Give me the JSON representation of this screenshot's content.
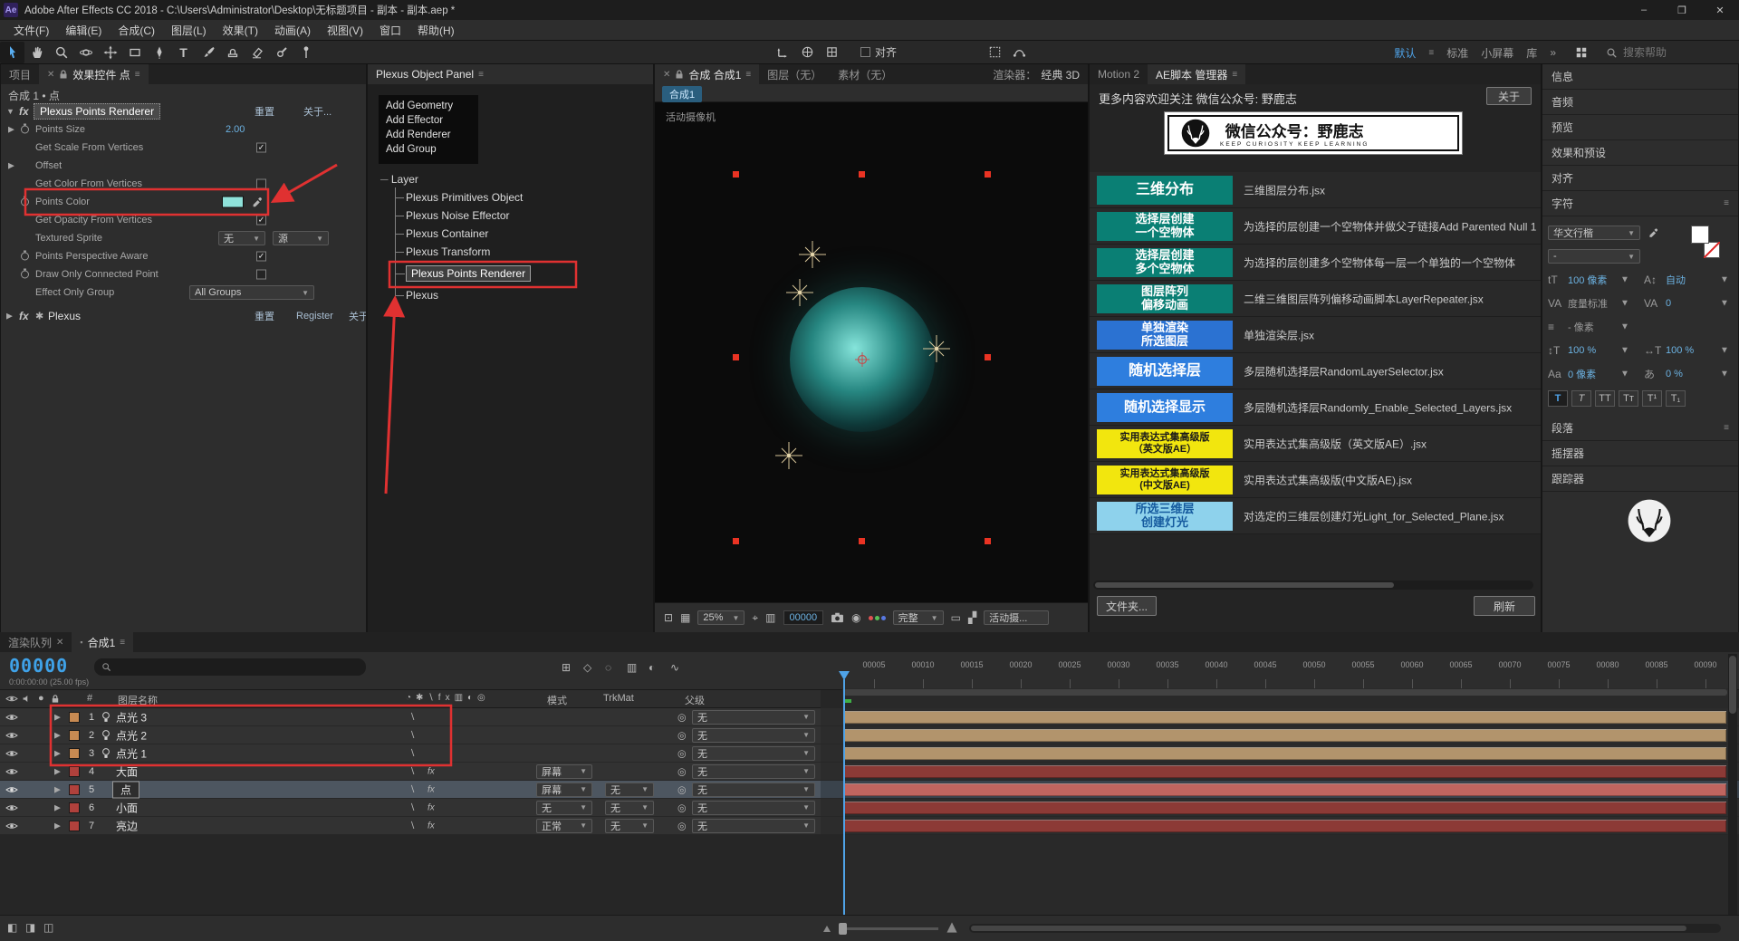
{
  "colors": {
    "accent": "#3fa2e8",
    "annotation": "#e03131",
    "value": "#6cb2e2"
  },
  "window": {
    "badge": "Ae",
    "title": "Adobe After Effects CC 2018 - C:\\Users\\Administrator\\Desktop\\无标题项目 - 副本 - 副本.aep *",
    "minimize": "–",
    "maximize": "❐",
    "close": "✕"
  },
  "menubar": {
    "items": [
      "文件(F)",
      "编辑(E)",
      "合成(C)",
      "图层(L)",
      "效果(T)",
      "动画(A)",
      "视图(V)",
      "窗口",
      "帮助(H)"
    ]
  },
  "toolbar": {
    "snap_label": "对齐",
    "workspaces": [
      "默认",
      "标准",
      "小屏幕",
      "库"
    ],
    "more": "»",
    "search_placeholder": "搜索帮助"
  },
  "effects_panel": {
    "tab_project": "项目",
    "tab_title": "效果控件 点",
    "breadcrumb": "合成 1 • 点",
    "ppr": {
      "fx": "fx",
      "title": "Plexus Points Renderer",
      "reset": "重置",
      "about": "关于...",
      "points_size_label": "Points Size",
      "points_size_value": "2.00",
      "get_scale_label": "Get Scale From Vertices",
      "get_scale_checked": true,
      "offset_label": "Offset",
      "get_color_label": "Get Color From Vertices",
      "get_color_checked": false,
      "points_color_label": "Points Color",
      "points_color_swatch": "#8fe2da",
      "get_opacity_label": "Get Opacity From Vertices",
      "get_opacity_checked": true,
      "textured_sprite_label": "Textured Sprite",
      "textured_sprite_layer": "无",
      "textured_sprite_source": "源",
      "perspective_label": "Points Perspective Aware",
      "perspective_checked": true,
      "draw_connected_label": "Draw Only Connected Point",
      "draw_connected_checked": false,
      "effect_group_label": "Effect Only Group",
      "effect_group_value": "All Groups"
    },
    "plexus": {
      "fx": "fx",
      "title": "Plexus",
      "reset": "重置",
      "register": "Register",
      "about": "关于..."
    }
  },
  "plexus_panel": {
    "title": "Plexus Object Panel",
    "actions": [
      "Add Geometry",
      "Add Effector",
      "Add Renderer",
      "Add Group"
    ],
    "root": "Layer",
    "items": [
      "Plexus Primitives Object",
      "Plexus Noise Effector",
      "Plexus Container",
      "Plexus Transform",
      "Plexus Points Renderer",
      "Plexus"
    ]
  },
  "viewer": {
    "tab_comp": "合成 合成1",
    "tab_layer": "图层（无）",
    "tab_footage": "素材（无）",
    "renderer_label": "渲染器：",
    "renderer_value": "经典 3D",
    "nav_badge": "合成1",
    "camera_overlay": "活动摄像机",
    "zoom": "25%",
    "timecode": "00000",
    "resolution": "完整",
    "view": "活动摄..."
  },
  "scripts_panel": {
    "tab_motion": "Motion 2",
    "tab_manager": "AE脚本 管理器",
    "header": "更多内容欢迎关注 微信公众号: 野鹿志",
    "about_btn": "关于",
    "banner_title": "微信公众号：野鹿志",
    "banner_sub": "KEEP CURIOSITY KEEP LEARNING",
    "rows": [
      {
        "label": "三维分布",
        "bg": "#0a7f74",
        "fg": "#ffffff",
        "desc": "三维图层分布.jsx"
      },
      {
        "label": "选择层创建\n一个空物体",
        "bg": "#0a7f74",
        "fg": "#ffffff",
        "desc": "为选择的层创建一个空物体并做父子链接Add Parented Null 1"
      },
      {
        "label": "选择层创建\n多个空物体",
        "bg": "#0a7f74",
        "fg": "#ffffff",
        "desc": "为选择的层创建多个空物体每一层一个单独的一个空物体"
      },
      {
        "label": "图层阵列\n偏移动画",
        "bg": "#0a7f74",
        "fg": "#ffffff",
        "desc": "二维三维图层阵列偏移动画脚本LayerRepeater.jsx"
      },
      {
        "label": "单独渲染\n所选图层",
        "bg": "#2b72d2",
        "fg": "#ffffff",
        "desc": "单独渲染层.jsx"
      },
      {
        "label": "随机选择层",
        "bg": "#2e7ede",
        "fg": "#ffffff",
        "desc": "多层随机选择层RandomLayerSelector.jsx"
      },
      {
        "label": "随机选择显示",
        "bg": "#2e7ede",
        "fg": "#ffffff",
        "desc": "多层随机选择层Randomly_Enable_Selected_Layers.jsx"
      },
      {
        "label": "实用表达式集高级版\n（英文版AE）",
        "bg": "#f2e60e",
        "fg": "#1a1a1a",
        "desc": "实用表达式集高级版（英文版AE）.jsx"
      },
      {
        "label": "实用表达式集高级版\n(中文版AE)",
        "bg": "#f2e60e",
        "fg": "#1a1a1a",
        "desc": "实用表达式集高级版(中文版AE).jsx"
      },
      {
        "label": "所选三维层\n创建灯光",
        "bg": "#8ed2ec",
        "fg": "#155a9e",
        "desc": "对选定的三维层创建灯光Light_for_Selected_Plane.jsx"
      }
    ],
    "folder_btn": "文件夹...",
    "refresh_btn": "刷新"
  },
  "dock": {
    "info": "信息",
    "audio": "音频",
    "preview": "预览",
    "effects_presets": "效果和预设",
    "align": "对齐",
    "character": "字符",
    "paragraph": "段落",
    "wiggler": "摇摆器",
    "tracker": "跟踪器"
  },
  "character": {
    "font": "华文行楷",
    "style": "-",
    "size": "100 像素",
    "leading": "自动",
    "kerning": "度量标准",
    "tracking": "0",
    "spacing": "- 像素",
    "vscale": "100 %",
    "hscale": "100 %",
    "baseline": "0 像素",
    "tsume": "0 %",
    "toggles": [
      "T",
      "T",
      "TT",
      "Tт",
      "T¹",
      "T₁"
    ]
  },
  "timeline": {
    "tab_queue": "渲染队列",
    "tab_comp": "合成1",
    "timecode": "00000",
    "rate": "0:00:00:00 (25.00 fps)",
    "headers": {
      "index": "#",
      "name": "图层名称",
      "mode": "模式",
      "trkmat": "TrkMat",
      "parent": "父级"
    },
    "ruler": [
      "00005",
      "00010",
      "00015",
      "00020",
      "00025",
      "00030",
      "00035",
      "00040",
      "00045",
      "00050",
      "00055",
      "00060",
      "00065",
      "00070",
      "00075",
      "00080",
      "00085",
      "00090"
    ],
    "layers": [
      {
        "index": "1",
        "name": "点光 3",
        "parent": "无",
        "chip": "#c78a52",
        "bar": "#b2946c"
      },
      {
        "index": "2",
        "name": "点光 2",
        "parent": "无",
        "chip": "#c78a52",
        "bar": "#b2946c"
      },
      {
        "index": "3",
        "name": "点光 1",
        "parent": "无",
        "chip": "#c78a52",
        "bar": "#b2946c"
      },
      {
        "index": "4",
        "name": "大面",
        "mode": "屏幕",
        "parent": "无",
        "chip": "#b0413c",
        "bar": "#8c3a36"
      },
      {
        "index": "5",
        "name": "点",
        "mode": "屏幕",
        "trkmat": "无",
        "parent": "无",
        "chip": "#b0413c",
        "bar": "#c0655f"
      },
      {
        "index": "6",
        "name": "小面",
        "mode": "无",
        "trkmat": "无",
        "parent": "无",
        "chip": "#b0413c",
        "bar": "#8c3a36"
      },
      {
        "index": "7",
        "name": "亮边",
        "mode": "正常",
        "trkmat": "无",
        "parent": "无",
        "chip": "#b0413c",
        "bar": "#8c3a36"
      }
    ]
  }
}
